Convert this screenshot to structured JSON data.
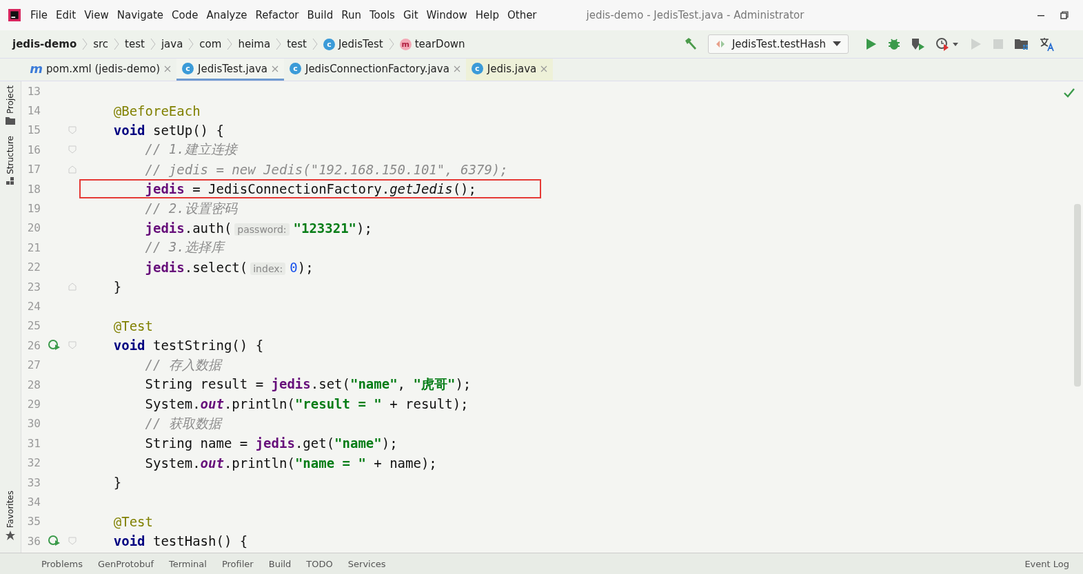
{
  "menu": [
    "File",
    "Edit",
    "View",
    "Navigate",
    "Code",
    "Analyze",
    "Refactor",
    "Build",
    "Run",
    "Tools",
    "Git",
    "Window",
    "Help",
    "Other"
  ],
  "window": {
    "title": "jedis-demo - JedisTest.java - Administrator"
  },
  "breadcrumbs": [
    {
      "label": "jedis-demo",
      "kind": "project"
    },
    {
      "label": "src",
      "kind": "folder"
    },
    {
      "label": "test",
      "kind": "folder"
    },
    {
      "label": "java",
      "kind": "folder"
    },
    {
      "label": "com",
      "kind": "folder"
    },
    {
      "label": "heima",
      "kind": "folder"
    },
    {
      "label": "test",
      "kind": "folder"
    },
    {
      "label": "JedisTest",
      "kind": "class",
      "badge": "c"
    },
    {
      "label": "tearDown",
      "kind": "method",
      "badge": "m"
    }
  ],
  "run_config": {
    "label": "JedisTest.testHash"
  },
  "toolbar": [
    {
      "kind": "build",
      "disabled": false
    },
    {
      "kind": "run",
      "disabled": false
    },
    {
      "kind": "debug",
      "disabled": false
    },
    {
      "kind": "coverage",
      "disabled": false
    },
    {
      "kind": "profile",
      "disabled": false
    },
    {
      "kind": "run",
      "disabled": true
    },
    {
      "kind": "stop",
      "disabled": true
    },
    {
      "kind": "structure",
      "disabled": false
    },
    {
      "kind": "translate",
      "disabled": false
    }
  ],
  "tabs": [
    {
      "label": "pom.xml (jedis-demo)",
      "kind": "maven",
      "badge": "m",
      "selected": false,
      "library": false
    },
    {
      "label": "JedisTest.java",
      "kind": "class",
      "badge": "c",
      "selected": true,
      "library": false
    },
    {
      "label": "JedisConnectionFactory.java",
      "kind": "class",
      "badge": "c",
      "selected": false,
      "library": false
    },
    {
      "label": "Jedis.java",
      "kind": "class",
      "badge": "c",
      "selected": false,
      "library": true
    }
  ],
  "side_tools": [
    {
      "label": "Project",
      "kind": "folder"
    },
    {
      "label": "Structure",
      "kind": "structure"
    }
  ],
  "side_tools_bottom": [
    {
      "label": "Favorites",
      "kind": "star"
    }
  ],
  "lines": [
    {
      "number": "13",
      "run": false,
      "fold_start": false,
      "fold_end": false,
      "boxed": false
    },
    {
      "number": "14",
      "run": false,
      "fold_start": false,
      "fold_end": false,
      "boxed": false,
      "tokens": [
        {
          "kind": "annotation",
          "text": "    @BeforeEach"
        }
      ]
    },
    {
      "number": "15",
      "run": false,
      "fold_start": true,
      "fold_end": false,
      "boxed": false,
      "tokens": [
        {
          "kind": "keyword",
          "text": "    void"
        },
        {
          "kind": "plain",
          "text": " setUp() {"
        }
      ]
    },
    {
      "number": "16",
      "run": false,
      "fold_start": true,
      "fold_end": false,
      "boxed": false,
      "tokens": [
        {
          "kind": "comment",
          "text": "        // 1.建立连接"
        }
      ]
    },
    {
      "number": "17",
      "run": false,
      "fold_start": false,
      "fold_end": true,
      "boxed": false,
      "tokens": [
        {
          "kind": "comment",
          "text": "        // jedis = new Jedis(\"192.168.150.101\", 6379);"
        }
      ]
    },
    {
      "number": "18",
      "run": false,
      "fold_start": false,
      "fold_end": false,
      "boxed": true,
      "tokens": [
        {
          "kind": "field",
          "text": "        jedis"
        },
        {
          "kind": "plain",
          "text": " = JedisConnectionFactory."
        },
        {
          "kind": "static",
          "text": "getJedis"
        },
        {
          "kind": "plain",
          "text": "();"
        }
      ]
    },
    {
      "number": "19",
      "run": false,
      "fold_start": false,
      "fold_end": false,
      "boxed": false,
      "tokens": [
        {
          "kind": "comment",
          "text": "        // 2.设置密码"
        }
      ]
    },
    {
      "number": "20",
      "run": false,
      "fold_start": false,
      "fold_end": false,
      "boxed": false,
      "tokens": [
        {
          "kind": "field",
          "text": "        jedis"
        },
        {
          "kind": "plain",
          "text": ".auth("
        },
        {
          "kind": "hint",
          "text": "password:"
        },
        {
          "kind": "string",
          "text": "\"123321\""
        },
        {
          "kind": "plain",
          "text": ");"
        }
      ]
    },
    {
      "number": "21",
      "run": false,
      "fold_start": false,
      "fold_end": false,
      "boxed": false,
      "tokens": [
        {
          "kind": "comment",
          "text": "        // 3.选择库"
        }
      ]
    },
    {
      "number": "22",
      "run": false,
      "fold_start": false,
      "fold_end": false,
      "boxed": false,
      "tokens": [
        {
          "kind": "field",
          "text": "        jedis"
        },
        {
          "kind": "plain",
          "text": ".select("
        },
        {
          "kind": "hint",
          "text": "index:"
        },
        {
          "kind": "number",
          "text": "0"
        },
        {
          "kind": "plain",
          "text": ");"
        }
      ]
    },
    {
      "number": "23",
      "run": false,
      "fold_start": false,
      "fold_end": true,
      "boxed": false,
      "tokens": [
        {
          "kind": "plain",
          "text": "    }"
        }
      ]
    },
    {
      "number": "24",
      "run": false,
      "fold_start": false,
      "fold_end": false,
      "boxed": false
    },
    {
      "number": "25",
      "run": false,
      "fold_start": false,
      "fold_end": false,
      "boxed": false,
      "tokens": [
        {
          "kind": "annotation",
          "text": "    @Test"
        }
      ]
    },
    {
      "number": "26",
      "run": true,
      "fold_start": true,
      "fold_end": false,
      "boxed": false,
      "tokens": [
        {
          "kind": "keyword",
          "text": "    void"
        },
        {
          "kind": "plain",
          "text": " testString() {"
        }
      ]
    },
    {
      "number": "27",
      "run": false,
      "fold_start": false,
      "fold_end": false,
      "boxed": false,
      "tokens": [
        {
          "kind": "comment",
          "text": "        // 存入数据"
        }
      ]
    },
    {
      "number": "28",
      "run": false,
      "fold_start": false,
      "fold_end": false,
      "boxed": false,
      "tokens": [
        {
          "kind": "plain",
          "text": "        String result = "
        },
        {
          "kind": "field",
          "text": "jedis"
        },
        {
          "kind": "plain",
          "text": ".set("
        },
        {
          "kind": "string",
          "text": "\"name\""
        },
        {
          "kind": "plain",
          "text": ", "
        },
        {
          "kind": "string",
          "text": "\"虎哥\""
        },
        {
          "kind": "plain",
          "text": ");"
        }
      ]
    },
    {
      "number": "29",
      "run": false,
      "fold_start": false,
      "fold_end": false,
      "boxed": false,
      "tokens": [
        {
          "kind": "plain",
          "text": "        System."
        },
        {
          "kind": "static-field",
          "text": "out"
        },
        {
          "kind": "plain",
          "text": ".println("
        },
        {
          "kind": "string",
          "text": "\"result = \""
        },
        {
          "kind": "plain",
          "text": " + result);"
        }
      ]
    },
    {
      "number": "30",
      "run": false,
      "fold_start": false,
      "fold_end": false,
      "boxed": false,
      "tokens": [
        {
          "kind": "comment",
          "text": "        // 获取数据"
        }
      ]
    },
    {
      "number": "31",
      "run": false,
      "fold_start": false,
      "fold_end": false,
      "boxed": false,
      "tokens": [
        {
          "kind": "plain",
          "text": "        String name = "
        },
        {
          "kind": "field",
          "text": "jedis"
        },
        {
          "kind": "plain",
          "text": ".get("
        },
        {
          "kind": "string",
          "text": "\"name\""
        },
        {
          "kind": "plain",
          "text": ");"
        }
      ]
    },
    {
      "number": "32",
      "run": false,
      "fold_start": false,
      "fold_end": false,
      "boxed": false,
      "tokens": [
        {
          "kind": "plain",
          "text": "        System."
        },
        {
          "kind": "static-field",
          "text": "out"
        },
        {
          "kind": "plain",
          "text": ".println("
        },
        {
          "kind": "string",
          "text": "\"name = \""
        },
        {
          "kind": "plain",
          "text": " + name);"
        }
      ]
    },
    {
      "number": "33",
      "run": false,
      "fold_start": false,
      "fold_end": false,
      "boxed": false,
      "tokens": [
        {
          "kind": "plain",
          "text": "    }"
        }
      ]
    },
    {
      "number": "34",
      "run": false,
      "fold_start": false,
      "fold_end": false,
      "boxed": false
    },
    {
      "number": "35",
      "run": false,
      "fold_start": false,
      "fold_end": false,
      "boxed": false,
      "tokens": [
        {
          "kind": "annotation",
          "text": "    @Test"
        }
      ]
    },
    {
      "number": "36",
      "run": true,
      "fold_start": true,
      "fold_end": false,
      "boxed": false,
      "tokens": [
        {
          "kind": "keyword",
          "text": "    void"
        },
        {
          "kind": "plain",
          "text": " testHash() {"
        }
      ]
    }
  ],
  "bottom_tools": [
    "Problems",
    "GenProtobuf",
    "Terminal",
    "Profiler",
    "Build",
    "TODO",
    "Services"
  ],
  "event_log": "Event Log"
}
